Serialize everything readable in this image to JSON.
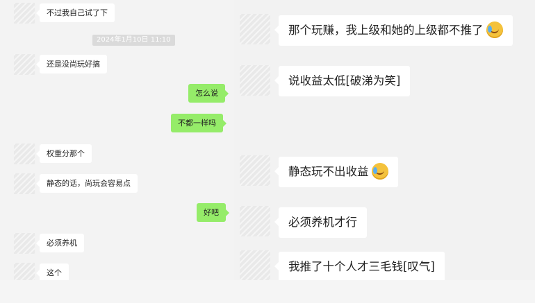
{
  "left_chat": {
    "timestamp": "2024年1月10日 11:10",
    "messages": [
      {
        "side": "other",
        "text": "不过我自己试了下"
      },
      {
        "side": "other",
        "text": "还是没尚玩好搞"
      },
      {
        "side": "self",
        "text": "怎么说"
      },
      {
        "side": "self",
        "text": "不都一样吗"
      },
      {
        "side": "other",
        "text": "权重分那个"
      },
      {
        "side": "other",
        "text": "静态的话，尚玩会容易点"
      },
      {
        "side": "self",
        "text": "好吧"
      },
      {
        "side": "other",
        "text": "必须养机"
      },
      {
        "side": "other",
        "text": "这个"
      }
    ]
  },
  "right_chat": {
    "messages": [
      {
        "text": "那个玩赚，我上级和她的上级都不推了",
        "emoji": "laughing-crying-emoji"
      },
      {
        "text": "说收益太低[破涕为笑]"
      },
      {
        "text": "静态玩不出收益",
        "emoji": "laughing-crying-emoji"
      },
      {
        "text": "必须养机才行"
      },
      {
        "text": "我推了十个人才三毛钱[叹气]"
      }
    ]
  }
}
